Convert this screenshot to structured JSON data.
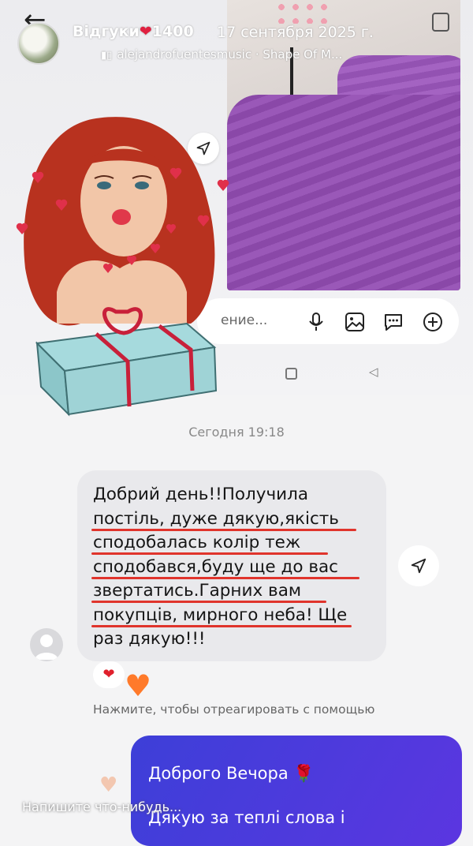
{
  "header": {
    "title": "Відгуки",
    "title_count": "1400",
    "heart": "❤",
    "date": "17 сентября 2025 г.",
    "music": "alejandrofuentesmusic · Shape Of M..."
  },
  "composer": {
    "placeholder": "ение..."
  },
  "chat": {
    "timestamp": "Сегодня 19:18",
    "incoming_message": "Добрий день!!Получила\nпостіль, дуже дякую,якість\nсподобалась колір теж\nсподобався,буду ще до вас\nзвертатись.Гарних вам\nпокупців, мирного неба! Ще\nраз дякую!!!",
    "reaction": "❤",
    "reaction_hint": "Нажмите, чтобы отреагировать с помощью",
    "outgoing_message": "Доброго Вечора 🌹\nДякую за теплі слова і"
  },
  "story_footer": {
    "placeholder": "Напишите что-нибудь..."
  },
  "colors": {
    "outgoing_bubble": "#4a3ad9",
    "underline": "#e0342c",
    "heart": "#e02040"
  }
}
